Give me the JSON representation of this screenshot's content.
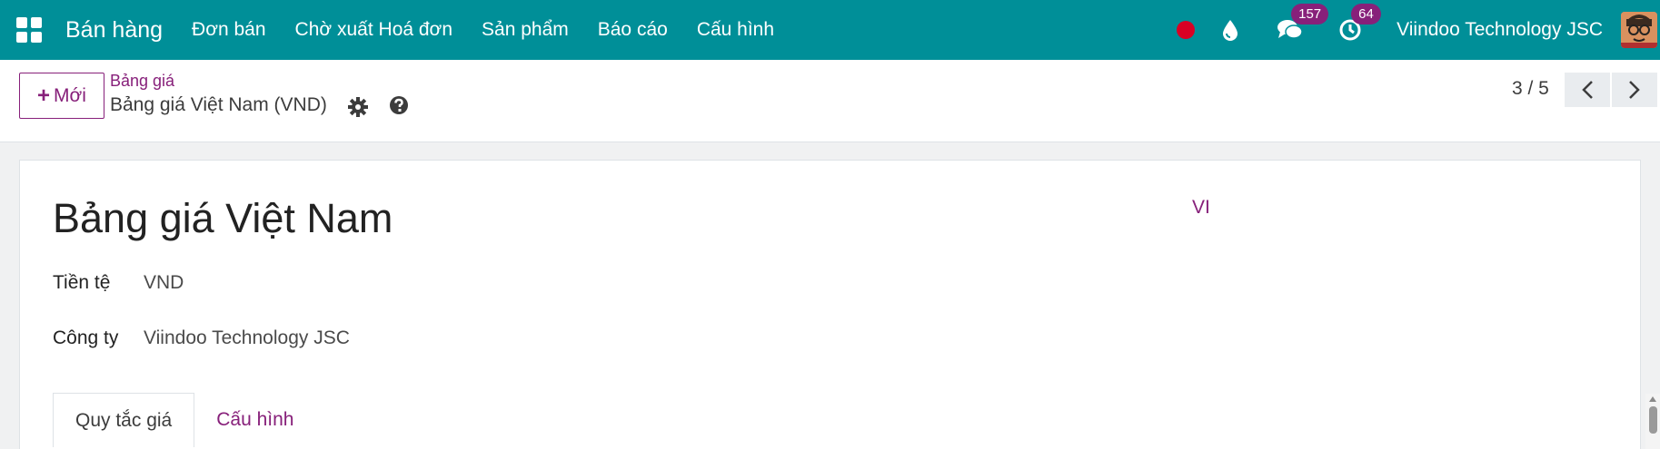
{
  "navbar": {
    "app_title": "Bán hàng",
    "menu": [
      "Đơn bán",
      "Chờ xuất Hoá đơn",
      "Sản phẩm",
      "Báo cáo",
      "Cấu hình"
    ],
    "messages_count": "157",
    "activities_count": "64",
    "company": "Viindoo Technology JSC",
    "accent_color": "#008f98"
  },
  "control_panel": {
    "new_label": "Mới",
    "breadcrumb": "Bảng giá",
    "record_title": "Bảng giá Việt Nam (VND)",
    "pager": "3 / 5"
  },
  "form": {
    "name": "Bảng giá Việt Nam",
    "lang": "VI",
    "currency_label": "Tiền tệ",
    "currency_value": "VND",
    "company_label": "Công ty",
    "company_value": "Viindoo Technology JSC",
    "tabs": [
      "Quy tắc giá",
      "Cấu hình"
    ]
  },
  "icons": {
    "apps": "apps-grid-icon",
    "recording": "record-dot-icon",
    "drop": "water-drop-icon",
    "chat": "chat-icon",
    "activity": "clock-icon",
    "settings": "gear-icon",
    "help": "question-circle-icon",
    "prev": "chevron-left-icon",
    "next": "chevron-right-icon"
  }
}
